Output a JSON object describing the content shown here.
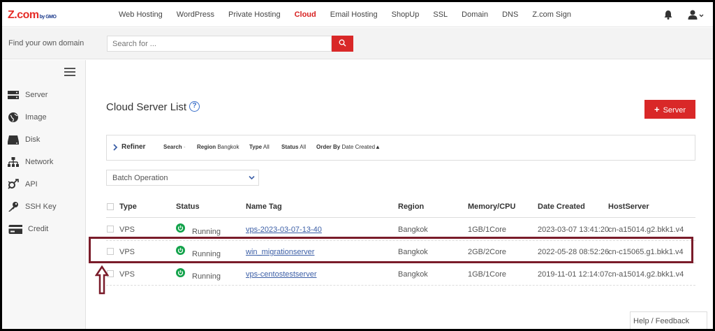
{
  "brand": {
    "logo": "Z.com",
    "logo_sub": "by GMO",
    "accent": "#d92828"
  },
  "nav": {
    "items": [
      "Web Hosting",
      "WordPress",
      "Private Hosting",
      "Cloud",
      "Email Hosting",
      "ShopUp",
      "SSL",
      "Domain",
      "DNS",
      "Z.com Sign"
    ],
    "active": "Cloud"
  },
  "search": {
    "label": "Find your own domain",
    "placeholder": "Search for ...",
    "button_icon": "search-icon"
  },
  "sidebar": {
    "items": [
      {
        "label": "Server",
        "icon": "server-icon"
      },
      {
        "label": "Image",
        "icon": "globe-icon"
      },
      {
        "label": "Disk",
        "icon": "disk-icon"
      },
      {
        "label": "Network",
        "icon": "network-icon"
      },
      {
        "label": "API",
        "icon": "api-icon"
      },
      {
        "label": "SSH Key",
        "icon": "key-icon"
      },
      {
        "label": "Credit",
        "icon": "credit-card-icon"
      }
    ]
  },
  "main": {
    "title": "Cloud Server List",
    "add_button": "Server",
    "refiner": {
      "label": "Refiner",
      "search": "Search",
      "region_label": "Region",
      "region_value": "Bangkok",
      "type_label": "Type",
      "type_value": "All",
      "status_label": "Status",
      "status_value": "All",
      "order_label": "Order By",
      "order_value": "Date Created▲"
    },
    "batch": "Batch Operation"
  },
  "table": {
    "headers": [
      "Type",
      "Status",
      "Name Tag",
      "Region",
      "Memory/CPU",
      "Date Created",
      "HostServer"
    ],
    "rows": [
      {
        "type": "VPS",
        "status": "Running",
        "name": "vps-2023-03-07-13-40",
        "region": "Bangkok",
        "mem": "1GB/1Core",
        "date": "2023-03-07 13:41:20",
        "host": "cn-a15014.g2.bkk1.v4"
      },
      {
        "type": "VPS",
        "status": "Running",
        "name": "win_migrationserver",
        "region": "Bangkok",
        "mem": "2GB/2Core",
        "date": "2022-05-28 08:52:26",
        "host": "cn-c15065.g1.bkk1.v4"
      },
      {
        "type": "VPS",
        "status": "Running",
        "name": "vps-centostestserver",
        "region": "Bangkok",
        "mem": "1GB/1Core",
        "date": "2019-11-01 12:14:07",
        "host": "cn-a15014.g2.bkk1.v4"
      }
    ],
    "status_color": "#12a24a"
  },
  "footer": {
    "help": "Help / Feedback"
  },
  "annotation": {
    "highlight_color": "#7a1c2a"
  }
}
